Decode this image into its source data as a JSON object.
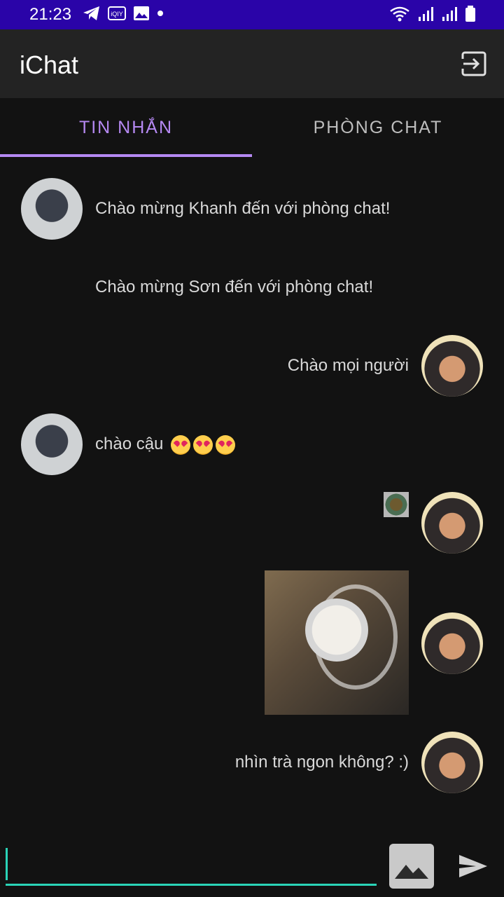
{
  "status": {
    "time": "21:23"
  },
  "app": {
    "title": "iChat"
  },
  "tabs": [
    {
      "label": "TIN NHẮN",
      "active": true
    },
    {
      "label": "PHÒNG CHAT",
      "active": false
    }
  ],
  "messages": [
    {
      "side": "left",
      "type": "text",
      "text": "Chào mừng Khanh đến với phòng chat!"
    },
    {
      "side": "left",
      "type": "text",
      "text": "Chào mừng Sơn đến với phòng chat!"
    },
    {
      "side": "right",
      "type": "text",
      "text": "Chào mọi người"
    },
    {
      "side": "left",
      "type": "text",
      "text": "chào cậu"
    },
    {
      "side": "right",
      "type": "image-small"
    },
    {
      "side": "right",
      "type": "image"
    },
    {
      "side": "right",
      "type": "text",
      "text": "nhìn trà ngon không? :)"
    }
  ],
  "composer": {
    "value": ""
  },
  "colors": {
    "status_bar": "#2a04a8",
    "accent": "#b589f2",
    "input_underline": "#2ad3b7"
  }
}
